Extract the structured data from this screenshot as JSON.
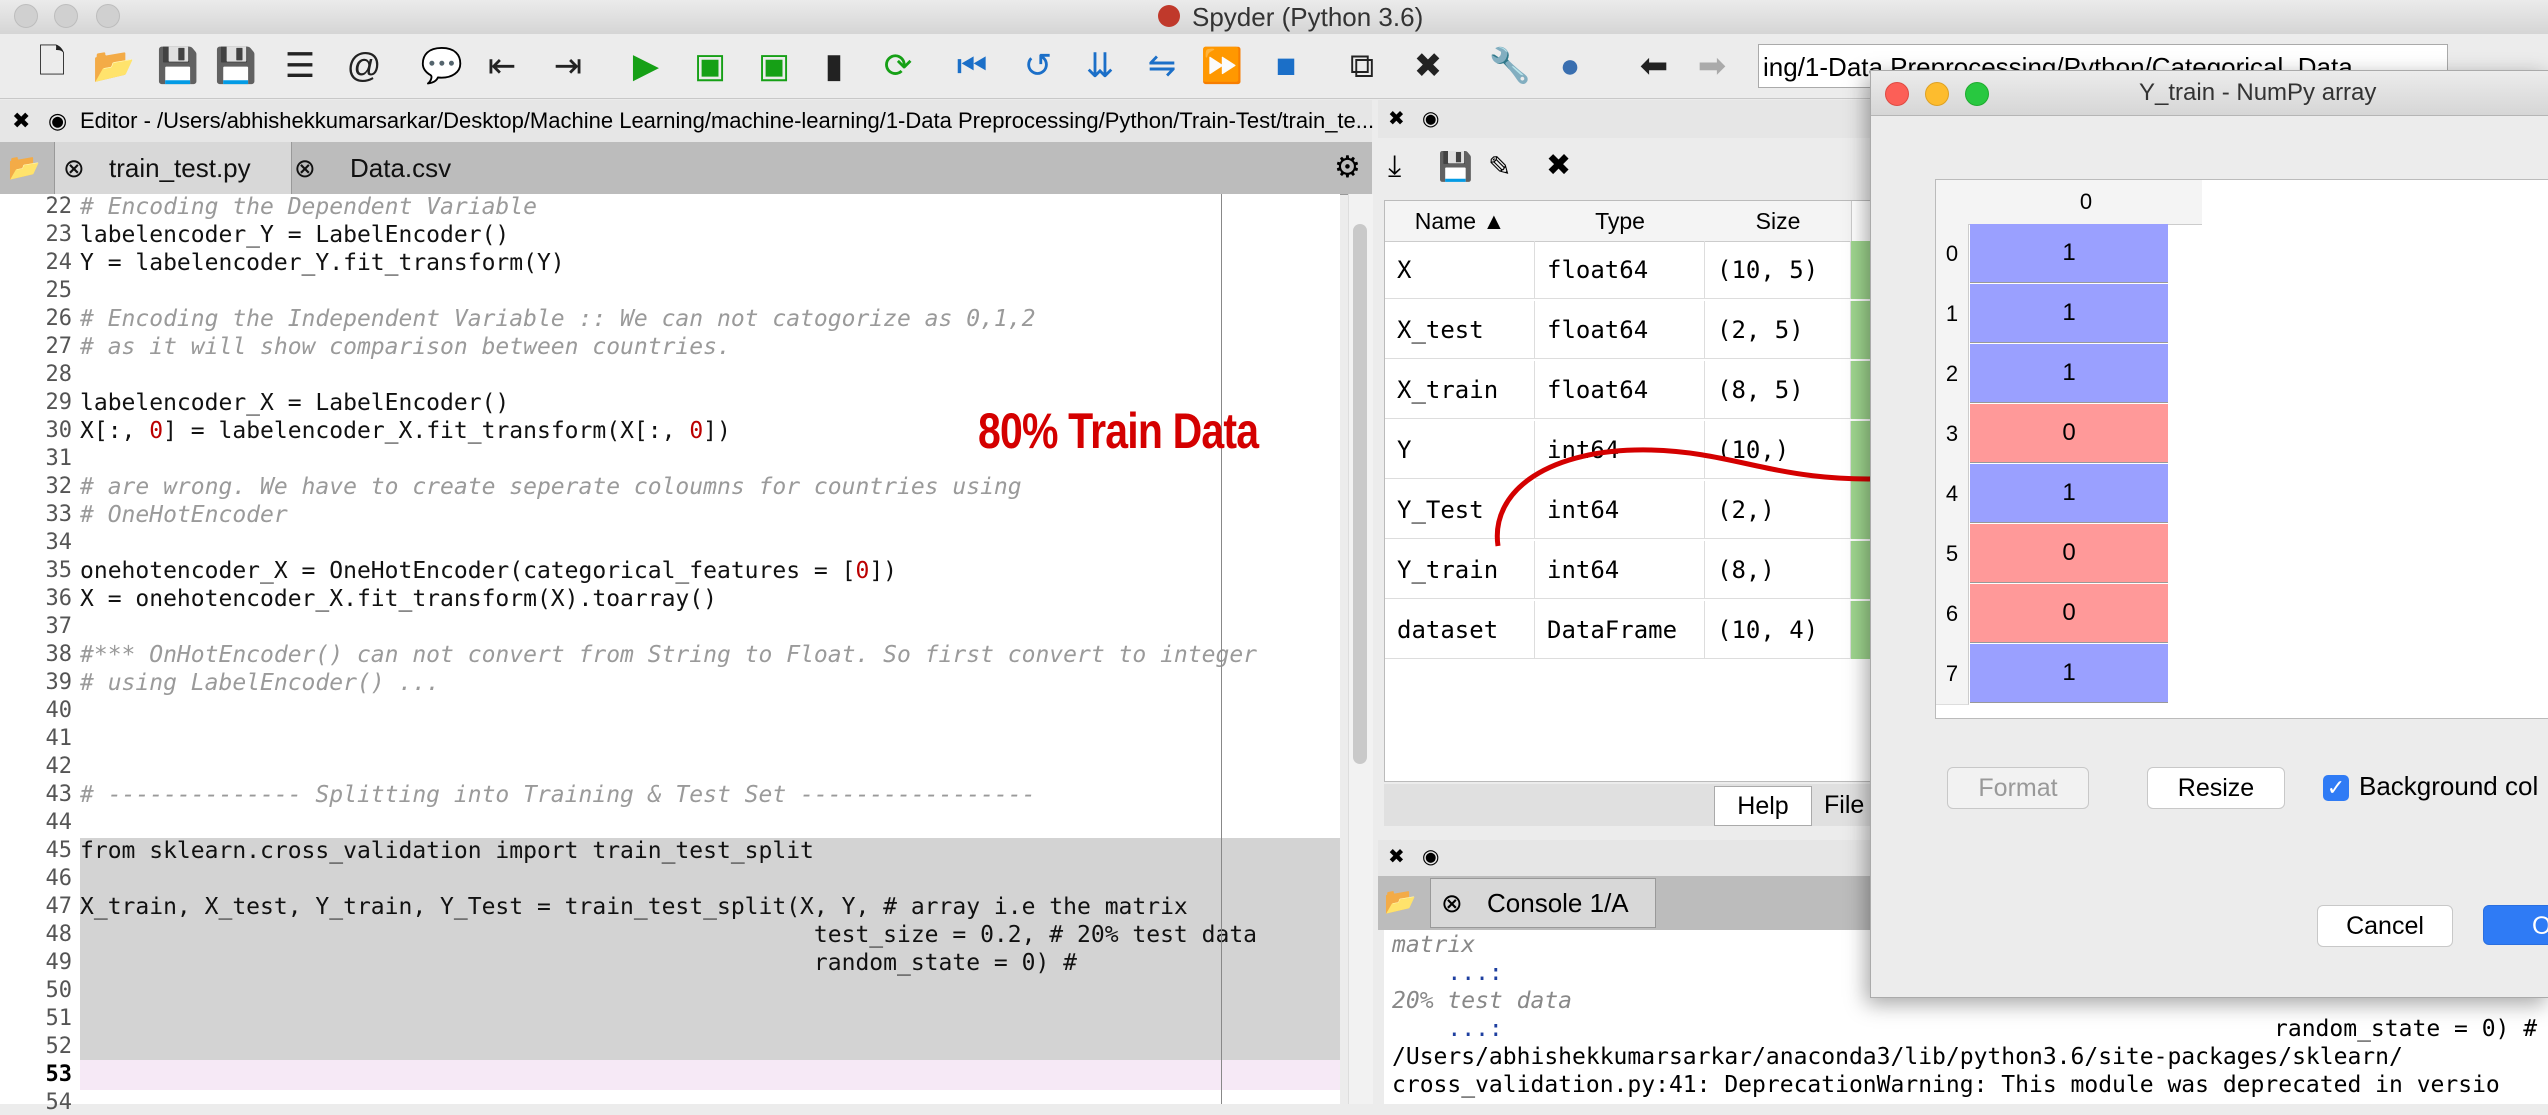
{
  "app": {
    "title": "Spyder (Python 3.6)"
  },
  "toolbar": {
    "path_combo": "ing/1-Data Preprocessing/Python/Categorical_Data"
  },
  "editor": {
    "header_path": "Editor - /Users/abhishekkumarsarkar/Desktop/Machine Learning/machine-learning/1-Data Preprocessing/Python/Train-Test/train_te...",
    "tabs": [
      "train_test.py",
      "Data.csv"
    ],
    "lines": [
      {
        "n": "22",
        "t": "# Encoding the Dependent Variable",
        "c": true
      },
      {
        "n": "23",
        "t": "labelencoder_Y = LabelEncoder()",
        "c": false
      },
      {
        "n": "24",
        "t": "Y = labelencoder_Y.fit_transform(Y)",
        "c": false
      },
      {
        "n": "25",
        "t": "",
        "c": false
      },
      {
        "n": "26",
        "t": "# Encoding the Independent Variable :: We can not catogorize as 0,1,2",
        "c": true
      },
      {
        "n": "27",
        "t": "# as it will show comparison between countries.",
        "c": true
      },
      {
        "n": "28",
        "t": "",
        "c": false
      },
      {
        "n": "29",
        "t": "labelencoder_X = LabelEncoder()",
        "c": false
      },
      {
        "n": "30",
        "t": "X[:, 0] = labelencoder_X.fit_transform(X[:, 0])",
        "c": false
      },
      {
        "n": "31",
        "t": "",
        "c": false
      },
      {
        "n": "32",
        "t": "# are wrong. We have to create seperate coloumns for countries using",
        "c": true
      },
      {
        "n": "33",
        "t": "# OneHotEncoder",
        "c": true
      },
      {
        "n": "34",
        "t": "",
        "c": false
      },
      {
        "n": "35",
        "t": "onehotencoder_X = OneHotEncoder(categorical_features = [0])",
        "c": false
      },
      {
        "n": "36",
        "t": "X = onehotencoder_X.fit_transform(X).toarray()",
        "c": false
      },
      {
        "n": "37",
        "t": "",
        "c": false
      },
      {
        "n": "38",
        "t": "#*** OnHotEncoder() can not convert from String to Float. So first convert to integer",
        "c": true
      },
      {
        "n": "39",
        "t": "# using LabelEncoder() ...",
        "c": true
      },
      {
        "n": "40",
        "t": "",
        "c": false
      },
      {
        "n": "41",
        "t": "",
        "c": false
      },
      {
        "n": "42",
        "t": "",
        "c": false
      },
      {
        "n": "43",
        "t": "# -------------- Splitting into Training & Test Set -----------------",
        "c": true
      },
      {
        "n": "44",
        "t": "",
        "c": false
      },
      {
        "n": "45",
        "t": "from sklearn.cross_validation import train_test_split",
        "c": false
      },
      {
        "n": "46",
        "t": "",
        "c": false
      },
      {
        "n": "47",
        "t": "X_train, X_test, Y_train, Y_Test = train_test_split(X, Y, # array i.e the matrix",
        "c": false
      },
      {
        "n": "48",
        "t": "                                                     test_size = 0.2, # 20% test data",
        "c": false
      },
      {
        "n": "49",
        "t": "                                                     random_state = 0) #",
        "c": false
      },
      {
        "n": "50",
        "t": "",
        "c": false
      },
      {
        "n": "51",
        "t": "",
        "c": false
      },
      {
        "n": "52",
        "t": "",
        "c": false
      },
      {
        "n": "53",
        "t": "",
        "c": false
      },
      {
        "n": "54",
        "t": "",
        "c": false
      }
    ]
  },
  "annotation": "80% Train Data",
  "variable_explorer": {
    "columns": [
      "Name",
      "Type",
      "Size"
    ],
    "rows": [
      {
        "name": "X",
        "type": "float64",
        "size": "(10, 5)"
      },
      {
        "name": "X_test",
        "type": "float64",
        "size": "(2, 5)"
      },
      {
        "name": "X_train",
        "type": "float64",
        "size": "(8, 5)"
      },
      {
        "name": "Y",
        "type": "int64",
        "size": "(10,)"
      },
      {
        "name": "Y_Test",
        "type": "int64",
        "size": "(2,)"
      },
      {
        "name": "Y_train",
        "type": "int64",
        "size": "(8,)"
      },
      {
        "name": "dataset",
        "type": "DataFrame",
        "size": "(10, 4)"
      }
    ],
    "bottom_tabs": [
      "Help",
      "File"
    ]
  },
  "console": {
    "tab": "Console 1/A",
    "lines": [
      "matrix",
      "    ...:",
      "20% test data",
      "    ...:",
      "/Users/abhishekkumarsarkar/anaconda3/lib/python3.6/site-packages/sklearn/",
      "cross_validation.py:41: DeprecationWarning: This module was deprecated in versio"
    ],
    "right_fragment": "random_state = 0) #"
  },
  "numpy_dialog": {
    "title": "Y_train - NumPy array",
    "col_header": "0",
    "rows": [
      {
        "idx": "0",
        "val": "1"
      },
      {
        "idx": "1",
        "val": "1"
      },
      {
        "idx": "2",
        "val": "1"
      },
      {
        "idx": "3",
        "val": "0"
      },
      {
        "idx": "4",
        "val": "1"
      },
      {
        "idx": "5",
        "val": "0"
      },
      {
        "idx": "6",
        "val": "0"
      },
      {
        "idx": "7",
        "val": "1"
      }
    ],
    "format_btn": "Format",
    "resize_btn": "Resize",
    "background_label": "Background col",
    "cancel_btn": "Cancel",
    "ok_btn": "OK"
  },
  "colors": {
    "one_cell": "#9aa0ff",
    "zero_cell": "#ff9999",
    "type_col_green": "#9fd68f"
  }
}
